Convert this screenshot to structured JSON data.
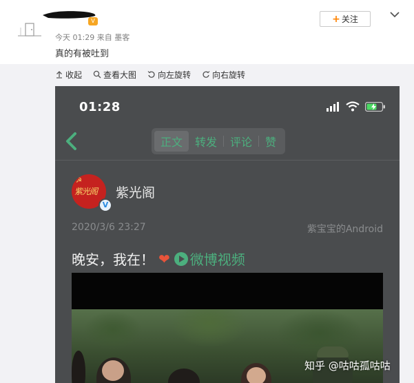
{
  "post": {
    "meta": "今天 01:29 来自 墨客",
    "text": "真的有被吐到",
    "follow_label": "关注",
    "follow_plus": "+"
  },
  "toolbar": {
    "collapse": "收起",
    "view_large": "查看大图",
    "rotate_left": "向左旋转",
    "rotate_right": "向右旋转"
  },
  "phone": {
    "time": "01:28",
    "tabs": [
      "正文",
      "转发",
      "评论",
      "赞"
    ],
    "active_tab": "正文",
    "author": "紫光阁",
    "avatar_text": "紫光阁",
    "verified": "V",
    "date": "2020/3/6 23:27",
    "source": "紫宝宝的Android",
    "body_text": "晚安，我在！",
    "video_label": "微博视频"
  },
  "watermark": "知乎 @咕咕孤咕咕",
  "colors": {
    "accent_green": "#4caf7e",
    "weibo_orange": "#ff8200",
    "phone_bg": "#4a4c4e",
    "avatar_red": "#c5221f"
  },
  "icons": {
    "collapse": "arrow-up-icon",
    "view_large": "magnifier-icon",
    "rotate_left": "rotate-left-icon",
    "rotate_right": "rotate-right-icon",
    "back": "chevron-left-icon",
    "more": "chevron-down-icon"
  }
}
